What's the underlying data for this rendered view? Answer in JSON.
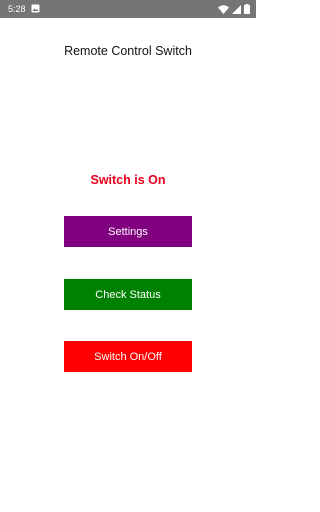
{
  "status_bar": {
    "time": "5:28",
    "icons": [
      "image-notification-icon",
      "wifi-icon",
      "signal-icon",
      "battery-icon"
    ],
    "background": "#757575"
  },
  "app": {
    "title": "Remote Control Switch"
  },
  "state": {
    "text": "Switch is On",
    "color": "#e8001c"
  },
  "buttons": {
    "settings": {
      "label": "Settings",
      "color": "#800080"
    },
    "check_status": {
      "label": "Check Status",
      "color": "#008000"
    },
    "toggle": {
      "label": "Switch On/Off",
      "color": "#ff0000"
    }
  }
}
